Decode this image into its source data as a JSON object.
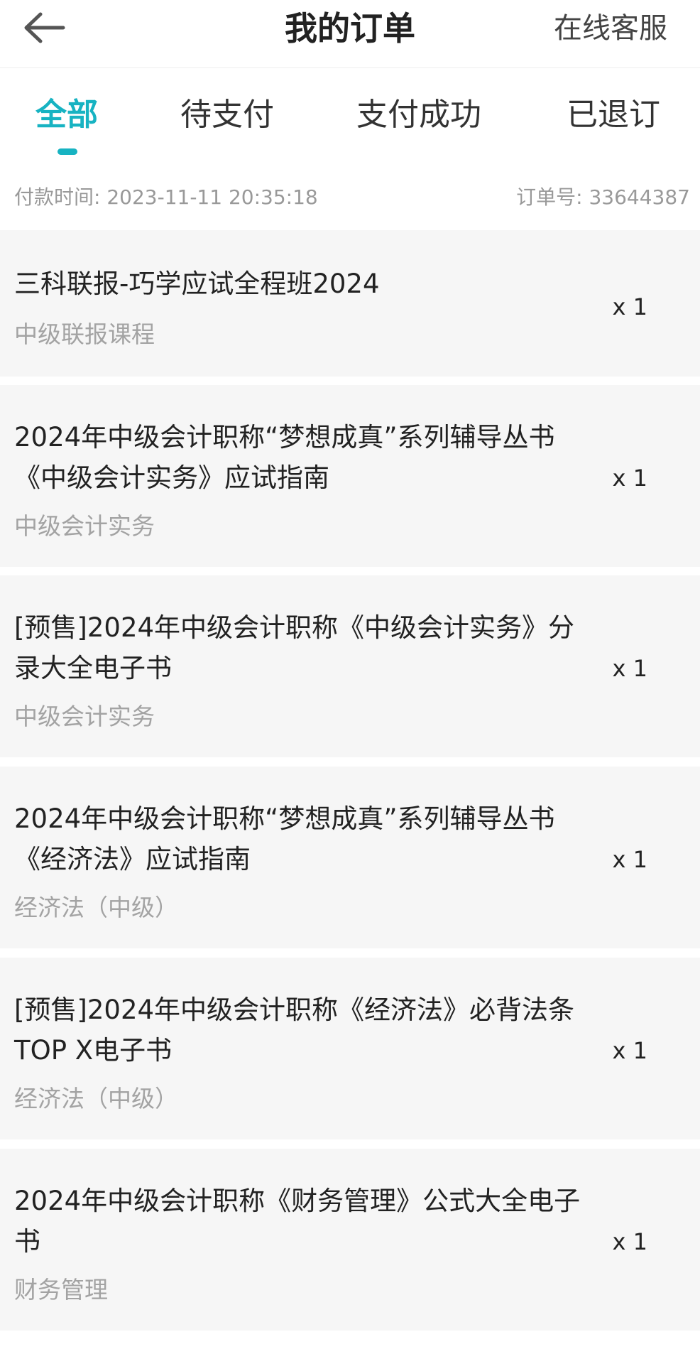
{
  "header": {
    "title": "我的订单",
    "service_label": "在线客服",
    "back_icon": "arrow-left-icon"
  },
  "tabs": [
    {
      "label": "全部",
      "active": true
    },
    {
      "label": "待支付",
      "active": false
    },
    {
      "label": "支付成功",
      "active": false
    },
    {
      "label": "已退订",
      "active": false
    }
  ],
  "order": {
    "pay_time": "付款时间: 2023-11-11 20:35:18",
    "order_no": "订单号: 33644387",
    "items": [
      {
        "title": "三科联报-巧学应试全程班2024",
        "subtitle": "中级联报课程",
        "qty": "x 1"
      },
      {
        "title": "2024年中级会计职称“梦想成真”系列辅导丛书《中级会计实务》应试指南",
        "subtitle": "中级会计实务",
        "qty": "x 1"
      },
      {
        "title": "[预售]2024年中级会计职称《中级会计实务》分录大全电子书",
        "subtitle": "中级会计实务",
        "qty": "x 1"
      },
      {
        "title": "2024年中级会计职称“梦想成真”系列辅导丛书《经济法》应试指南",
        "subtitle": "经济法（中级）",
        "qty": "x 1"
      },
      {
        "title": "[预售]2024年中级会计职称《经济法》必背法条TOP X电子书",
        "subtitle": "经济法（中级）",
        "qty": "x 1"
      },
      {
        "title": "2024年中级会计职称《财务管理》公式大全电子书",
        "subtitle": "财务管理",
        "qty": "x 1"
      }
    ]
  },
  "colors": {
    "accent": "#17b3c2",
    "item_background": "#f6f6f6",
    "muted_text": "#999999"
  }
}
